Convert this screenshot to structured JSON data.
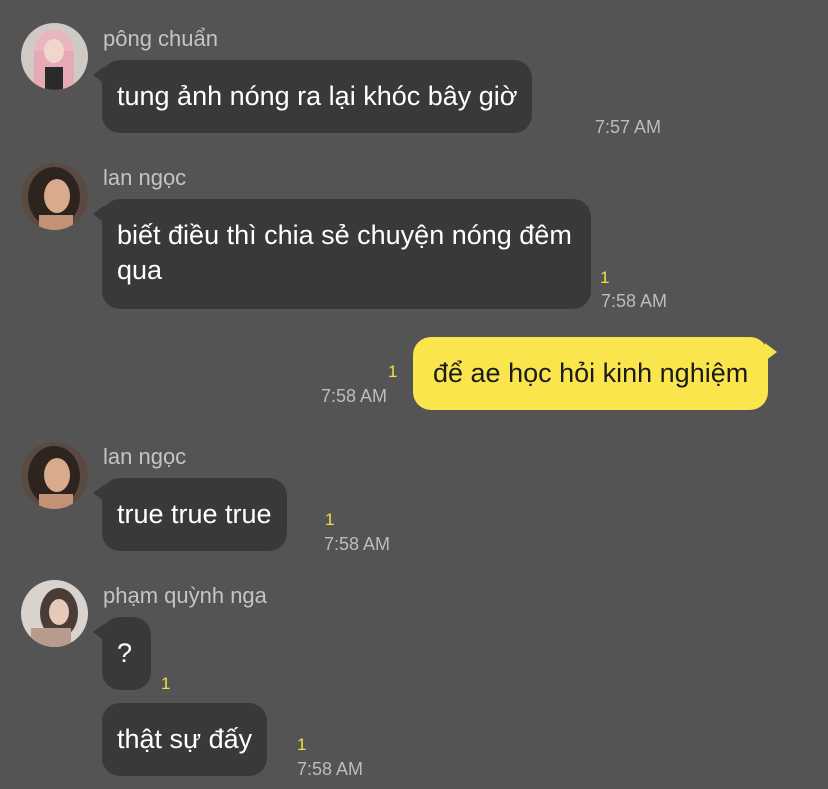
{
  "messages": [
    {
      "sender": "pông chuẩn",
      "avatar_icon": "avatar-pink-hair-icon",
      "bubbles": [
        {
          "text": "tung ảnh nóng ra lại khóc bây giờ",
          "unread": "",
          "time": "7:57 AM"
        }
      ]
    },
    {
      "sender": "lan ngọc",
      "avatar_icon": "avatar-dark-hair-icon",
      "bubbles": [
        {
          "text": "biết điều thì chia sẻ chuyện nóng đêm qua",
          "unread": "1",
          "time": "7:58 AM"
        }
      ]
    },
    {
      "outgoing": true,
      "bubbles": [
        {
          "text": "để ae học hỏi kinh nghiệm",
          "unread": "1",
          "time": "7:58 AM"
        }
      ]
    },
    {
      "sender": "lan ngọc",
      "avatar_icon": "avatar-dark-hair-icon",
      "bubbles": [
        {
          "text": "true true true",
          "unread": "1",
          "time": "7:58 AM"
        }
      ]
    },
    {
      "sender": "phạm quỳnh nga",
      "avatar_icon": "avatar-light-photo-icon",
      "bubbles": [
        {
          "text": "?",
          "unread": "1",
          "time": ""
        },
        {
          "text": "thật sự đấy",
          "unread": "1",
          "time": "7:58 AM"
        }
      ]
    }
  ],
  "colors": {
    "background": "#545454",
    "incoming_bubble": "#393939",
    "outgoing_bubble": "#fae64c",
    "unread_count": "#f3df3e",
    "timestamp": "#bcbcbc"
  }
}
